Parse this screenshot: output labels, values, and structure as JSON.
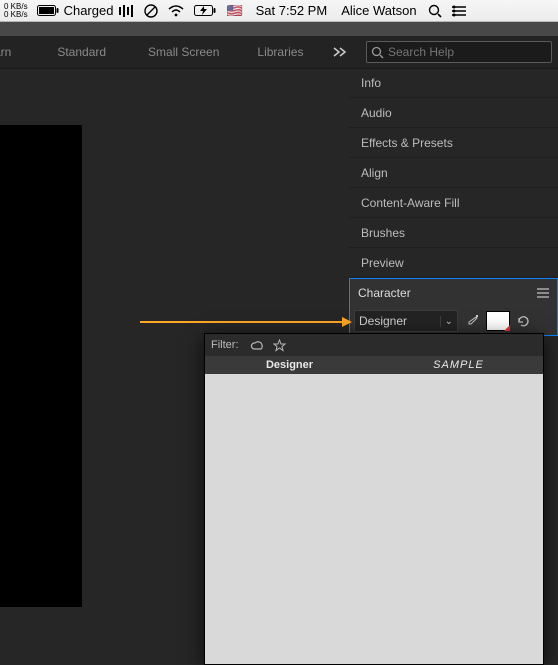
{
  "menubar": {
    "net_up": "0 KB/s",
    "net_down": "0 KB/s",
    "battery": "Charged",
    "clock": "Sat 7:52 PM",
    "user": "Alice Watson"
  },
  "tabs": {
    "t0": "arn",
    "t1": "Standard",
    "t2": "Small Screen",
    "t3": "Libraries"
  },
  "search": {
    "placeholder": "Search Help"
  },
  "panels": {
    "info": "Info",
    "audio": "Audio",
    "effects": "Effects & Presets",
    "align": "Align",
    "caf": "Content-Aware Fill",
    "brushes": "Brushes",
    "preview": "Preview",
    "character": "Character"
  },
  "character": {
    "font": "Designer"
  },
  "popup": {
    "filter_label": "Filter:",
    "col_name": "Designer",
    "col_sample": "SAMPLE"
  }
}
